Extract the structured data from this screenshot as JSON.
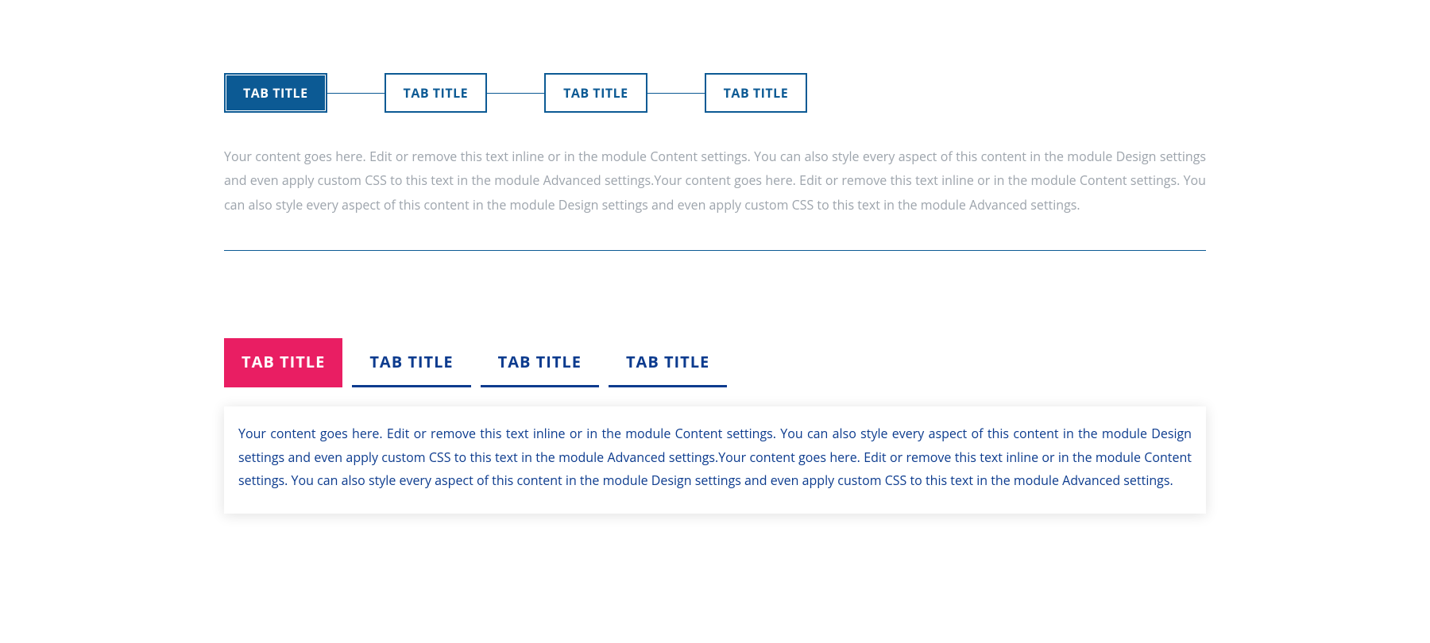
{
  "tabs1": {
    "items": [
      {
        "label": "TAB TITLE"
      },
      {
        "label": "TAB TITLE"
      },
      {
        "label": "TAB TITLE"
      },
      {
        "label": "TAB TITLE"
      }
    ],
    "content": "Your content goes here. Edit or remove this text inline or in the module Content settings. You can also style every aspect of this content in the module Design settings and even apply custom CSS to this text in the module Advanced settings.Your content goes here. Edit or remove this text inline or in the module Content settings. You can also style every aspect of this content in the module Design settings and even apply custom CSS to this text in the module Advanced settings."
  },
  "tabs2": {
    "items": [
      {
        "label": "TAB TITLE"
      },
      {
        "label": "TAB TITLE"
      },
      {
        "label": "TAB TITLE"
      },
      {
        "label": "TAB TITLE"
      }
    ],
    "content": "Your content goes here. Edit or remove this text inline or in the module Content settings. You can also style every aspect of this content in the module Design settings and even apply custom CSS to this text in the module Advanced settings.Your content goes here. Edit or remove this text inline or in the module Content settings. You can also style every aspect of this content in the module Design settings and even apply custom CSS to this text in the module Advanced settings."
  },
  "colors": {
    "blue": "#0c5a94",
    "darkblue": "#0c3b8e",
    "pink": "#e91e63",
    "grey": "#9da4ac"
  }
}
